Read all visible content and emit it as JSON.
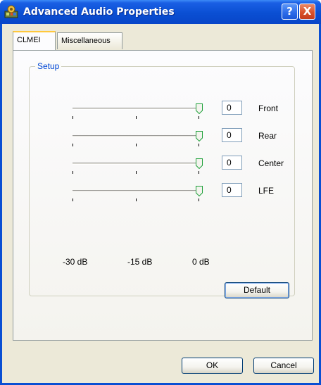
{
  "window": {
    "title": "Advanced Audio Properties"
  },
  "titlebar": {
    "help_glyph": "?",
    "close_glyph": "X",
    "icon": "audio-properties-icon"
  },
  "tabs": [
    {
      "label": "CLMEI",
      "active": true
    },
    {
      "label": "Miscellaneous",
      "active": false
    }
  ],
  "setup": {
    "group_label": "Setup",
    "channels": [
      {
        "name": "Front",
        "value": "0",
        "level_db": 0
      },
      {
        "name": "Rear",
        "value": "0",
        "level_db": 0
      },
      {
        "name": "Center",
        "value": "0",
        "level_db": 0
      },
      {
        "name": "LFE",
        "value": "0",
        "level_db": 0
      }
    ],
    "scale_labels": [
      "-30 dB",
      "-15 dB",
      "0 dB"
    ],
    "default_button": "Default"
  },
  "footer": {
    "ok_label": "OK",
    "cancel_label": "Cancel"
  },
  "colors": {
    "titlebar": "#0a4fd3",
    "group_label": "#0046d5",
    "active_tab_accent": "#ffc83c",
    "close_button": "#d9512b"
  }
}
